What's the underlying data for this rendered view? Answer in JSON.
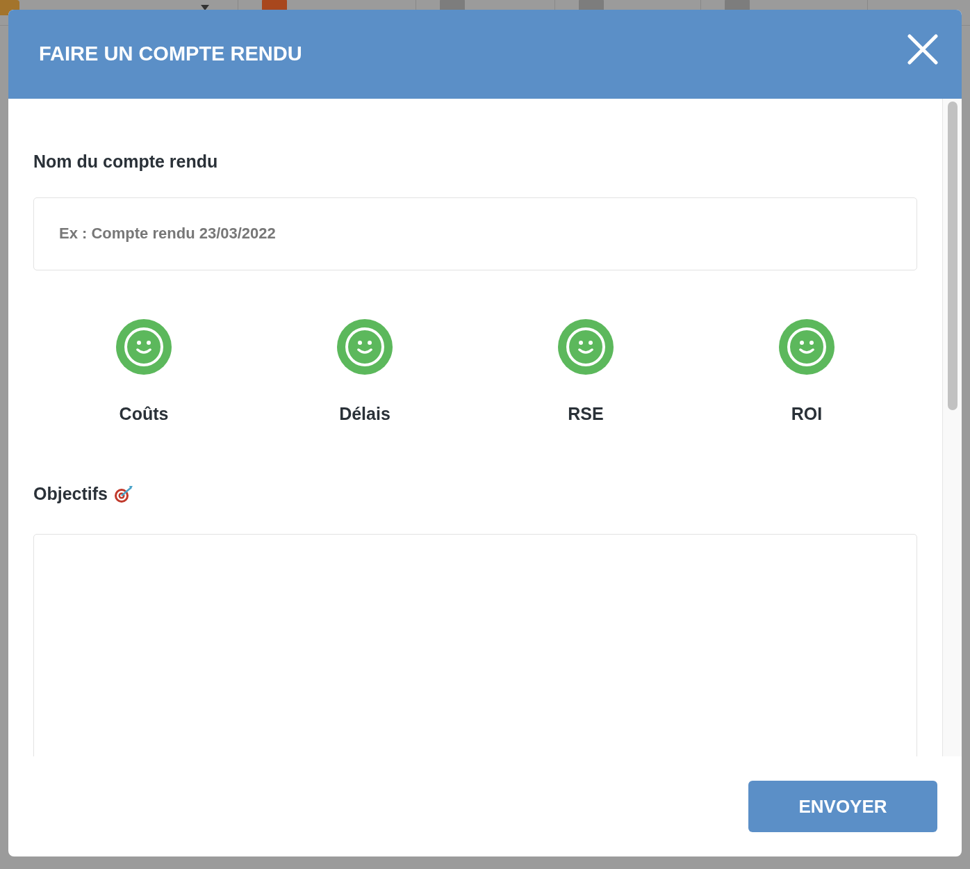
{
  "dialog": {
    "title": "FAIRE UN COMPTE RENDU",
    "name_label": "Nom du compte rendu",
    "name_field": {
      "placeholder": "Ex : Compte rendu 23/03/2022"
    },
    "indicators": [
      {
        "label": "Coûts",
        "color": "#5cb85c"
      },
      {
        "label": "Délais",
        "color": "#5cb85c"
      },
      {
        "label": "RSE",
        "color": "#5cb85c"
      },
      {
        "label": "ROI",
        "color": "#5cb85c"
      }
    ],
    "objectives_label": "Objectifs",
    "submit": "ENVOYER"
  }
}
